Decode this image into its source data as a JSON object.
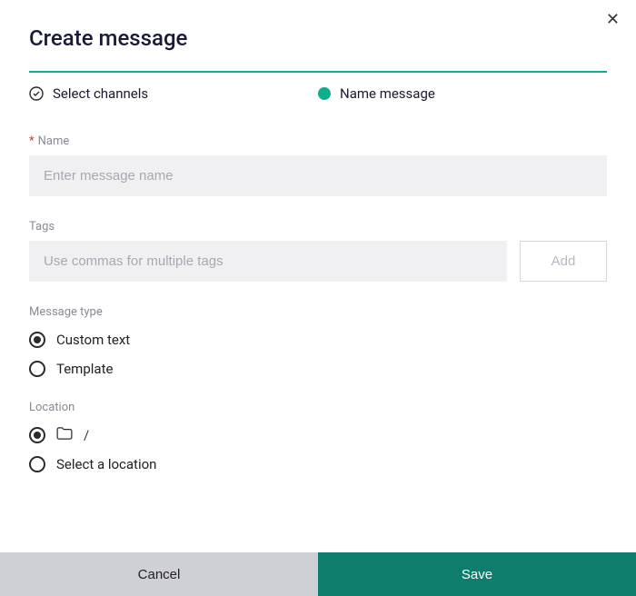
{
  "modal": {
    "title": "Create message",
    "steps": {
      "select_channels": "Select channels",
      "name_message": "Name message"
    },
    "name_field": {
      "label": "Name",
      "placeholder": "Enter message name",
      "value": ""
    },
    "tags_field": {
      "label": "Tags",
      "placeholder": "Use commas for multiple tags",
      "value": "",
      "add_label": "Add"
    },
    "message_type": {
      "label": "Message type",
      "options": {
        "custom": "Custom text",
        "template": "Template"
      }
    },
    "location": {
      "label": "Location",
      "root_path": "/",
      "select_label": "Select a location"
    },
    "footer": {
      "cancel": "Cancel",
      "save": "Save"
    }
  }
}
